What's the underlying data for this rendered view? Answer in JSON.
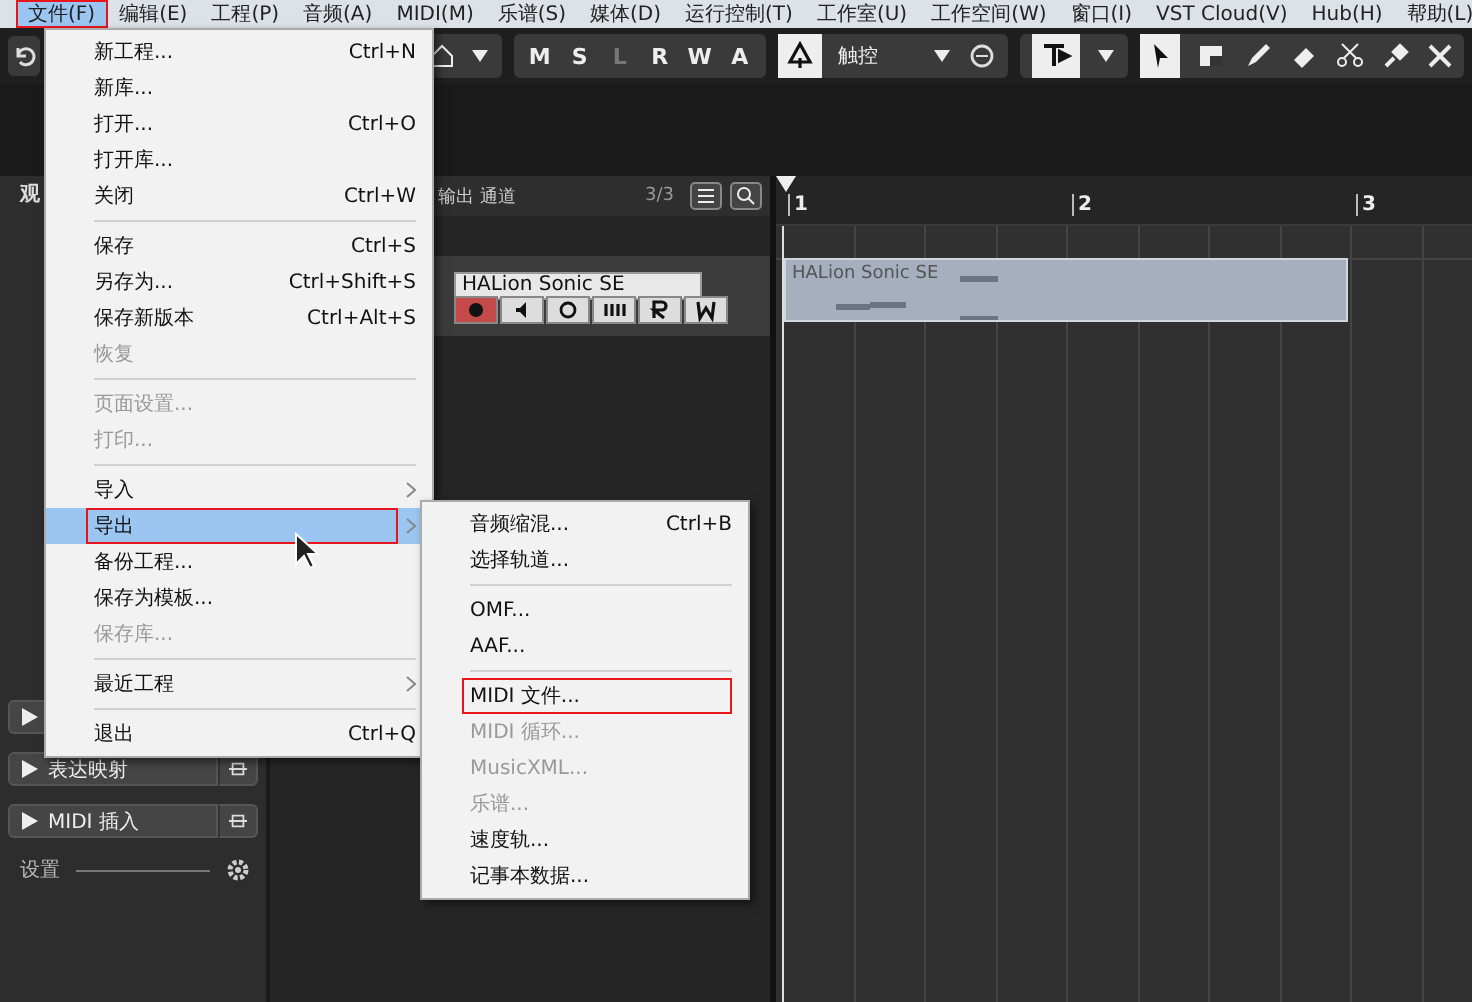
{
  "menubar": [
    {
      "label": "文件(F)",
      "selected": true,
      "highlighted": true
    },
    {
      "label": "编辑(E)",
      "selected": false,
      "highlighted": false
    },
    {
      "label": "工程(P)",
      "selected": false,
      "highlighted": false
    },
    {
      "label": "音频(A)",
      "selected": false,
      "highlighted": false
    },
    {
      "label": "MIDI(M)",
      "selected": false,
      "highlighted": false
    },
    {
      "label": "乐谱(S)",
      "selected": false,
      "highlighted": false
    },
    {
      "label": "媒体(D)",
      "selected": false,
      "highlighted": false
    },
    {
      "label": "运行控制(T)",
      "selected": false,
      "highlighted": false
    },
    {
      "label": "工作室(U)",
      "selected": false,
      "highlighted": false
    },
    {
      "label": "工作空间(W)",
      "selected": false,
      "highlighted": false
    },
    {
      "label": "窗口(I)",
      "selected": false,
      "highlighted": false
    },
    {
      "label": "VST Cloud(V)",
      "selected": false,
      "highlighted": false
    },
    {
      "label": "Hub(H)",
      "selected": false,
      "highlighted": false
    },
    {
      "label": "帮助(L)",
      "selected": false,
      "highlighted": false
    }
  ],
  "toolbar": {
    "mode_buttons": [
      {
        "label": "M",
        "dimmed": false
      },
      {
        "label": "S",
        "dimmed": false
      },
      {
        "label": "L",
        "dimmed": true
      },
      {
        "label": "R",
        "dimmed": false
      },
      {
        "label": "W",
        "dimmed": false
      },
      {
        "label": "A",
        "dimmed": false
      }
    ],
    "automation_mode": "触控"
  },
  "inspector": {
    "title": "观",
    "sections": [
      {
        "label": "表达映射"
      },
      {
        "label": "MIDI 插入"
      }
    ],
    "settings_label": "设置"
  },
  "track_list": {
    "header_label": "输出 通道",
    "count": "3/3",
    "track": {
      "instrument": "HALion Sonic SE"
    }
  },
  "arrangement": {
    "ruler": [
      "1",
      "2",
      "3"
    ],
    "event": {
      "name": "HALion Sonic SE"
    }
  },
  "file_menu": [
    {
      "kind": "item",
      "label": "新工程...",
      "shortcut": "Ctrl+N",
      "disabled": false,
      "submenu": false,
      "selected": false,
      "highlighted": false
    },
    {
      "kind": "item",
      "label": "新库...",
      "disabled": false,
      "submenu": false,
      "selected": false,
      "highlighted": false
    },
    {
      "kind": "item",
      "label": "打开...",
      "shortcut": "Ctrl+O",
      "disabled": false,
      "submenu": false,
      "selected": false,
      "highlighted": false
    },
    {
      "kind": "item",
      "label": "打开库...",
      "disabled": false,
      "submenu": false,
      "selected": false,
      "highlighted": false
    },
    {
      "kind": "item",
      "label": "关闭",
      "shortcut": "Ctrl+W",
      "disabled": false,
      "submenu": false,
      "selected": false,
      "highlighted": false
    },
    {
      "kind": "separator"
    },
    {
      "kind": "item",
      "label": "保存",
      "shortcut": "Ctrl+S",
      "disabled": false,
      "submenu": false,
      "selected": false,
      "highlighted": false
    },
    {
      "kind": "item",
      "label": "另存为...",
      "shortcut": "Ctrl+Shift+S",
      "disabled": false,
      "submenu": false,
      "selected": false,
      "highlighted": false
    },
    {
      "kind": "item",
      "label": "保存新版本",
      "shortcut": "Ctrl+Alt+S",
      "disabled": false,
      "submenu": false,
      "selected": false,
      "highlighted": false
    },
    {
      "kind": "item",
      "label": "恢复",
      "disabled": true,
      "submenu": false,
      "selected": false,
      "highlighted": false
    },
    {
      "kind": "separator"
    },
    {
      "kind": "item",
      "label": "页面设置...",
      "disabled": true,
      "submenu": false,
      "selected": false,
      "highlighted": false
    },
    {
      "kind": "item",
      "label": "打印...",
      "disabled": true,
      "submenu": false,
      "selected": false,
      "highlighted": false
    },
    {
      "kind": "separator"
    },
    {
      "kind": "item",
      "label": "导入",
      "disabled": false,
      "submenu": true,
      "selected": false,
      "highlighted": false
    },
    {
      "kind": "item",
      "label": "导出",
      "disabled": false,
      "submenu": true,
      "selected": true,
      "highlighted": true
    },
    {
      "kind": "item",
      "label": "备份工程...",
      "disabled": false,
      "submenu": false,
      "selected": false,
      "highlighted": false
    },
    {
      "kind": "item",
      "label": "保存为模板...",
      "disabled": false,
      "submenu": false,
      "selected": false,
      "highlighted": false
    },
    {
      "kind": "item",
      "label": "保存库...",
      "disabled": true,
      "submenu": false,
      "selected": false,
      "highlighted": false
    },
    {
      "kind": "separator"
    },
    {
      "kind": "item",
      "label": "最近工程",
      "disabled": false,
      "submenu": true,
      "selected": false,
      "highlighted": false
    },
    {
      "kind": "separator"
    },
    {
      "kind": "item",
      "label": "退出",
      "shortcut": "Ctrl+Q",
      "disabled": false,
      "submenu": false,
      "selected": false,
      "highlighted": false
    }
  ],
  "export_submenu": [
    {
      "kind": "item",
      "label": "音频缩混...",
      "shortcut": "Ctrl+B",
      "disabled": false,
      "highlighted": false
    },
    {
      "kind": "item",
      "label": "选择轨道...",
      "disabled": false,
      "highlighted": false
    },
    {
      "kind": "separator"
    },
    {
      "kind": "item",
      "label": "OMF...",
      "disabled": false,
      "highlighted": false
    },
    {
      "kind": "item",
      "label": "AAF...",
      "disabled": false,
      "highlighted": false
    },
    {
      "kind": "separator"
    },
    {
      "kind": "item",
      "label": "MIDI 文件...",
      "disabled": false,
      "highlighted": true
    },
    {
      "kind": "item",
      "label": "MIDI 循环...",
      "disabled": true,
      "highlighted": false
    },
    {
      "kind": "item",
      "label": "MusicXML...",
      "disabled": true,
      "highlighted": false
    },
    {
      "kind": "item",
      "label": "乐谱...",
      "disabled": true,
      "highlighted": false
    },
    {
      "kind": "item",
      "label": "速度轨...",
      "disabled": false,
      "highlighted": false
    },
    {
      "kind": "item",
      "label": "记事本数据...",
      "disabled": false,
      "highlighted": false
    }
  ]
}
